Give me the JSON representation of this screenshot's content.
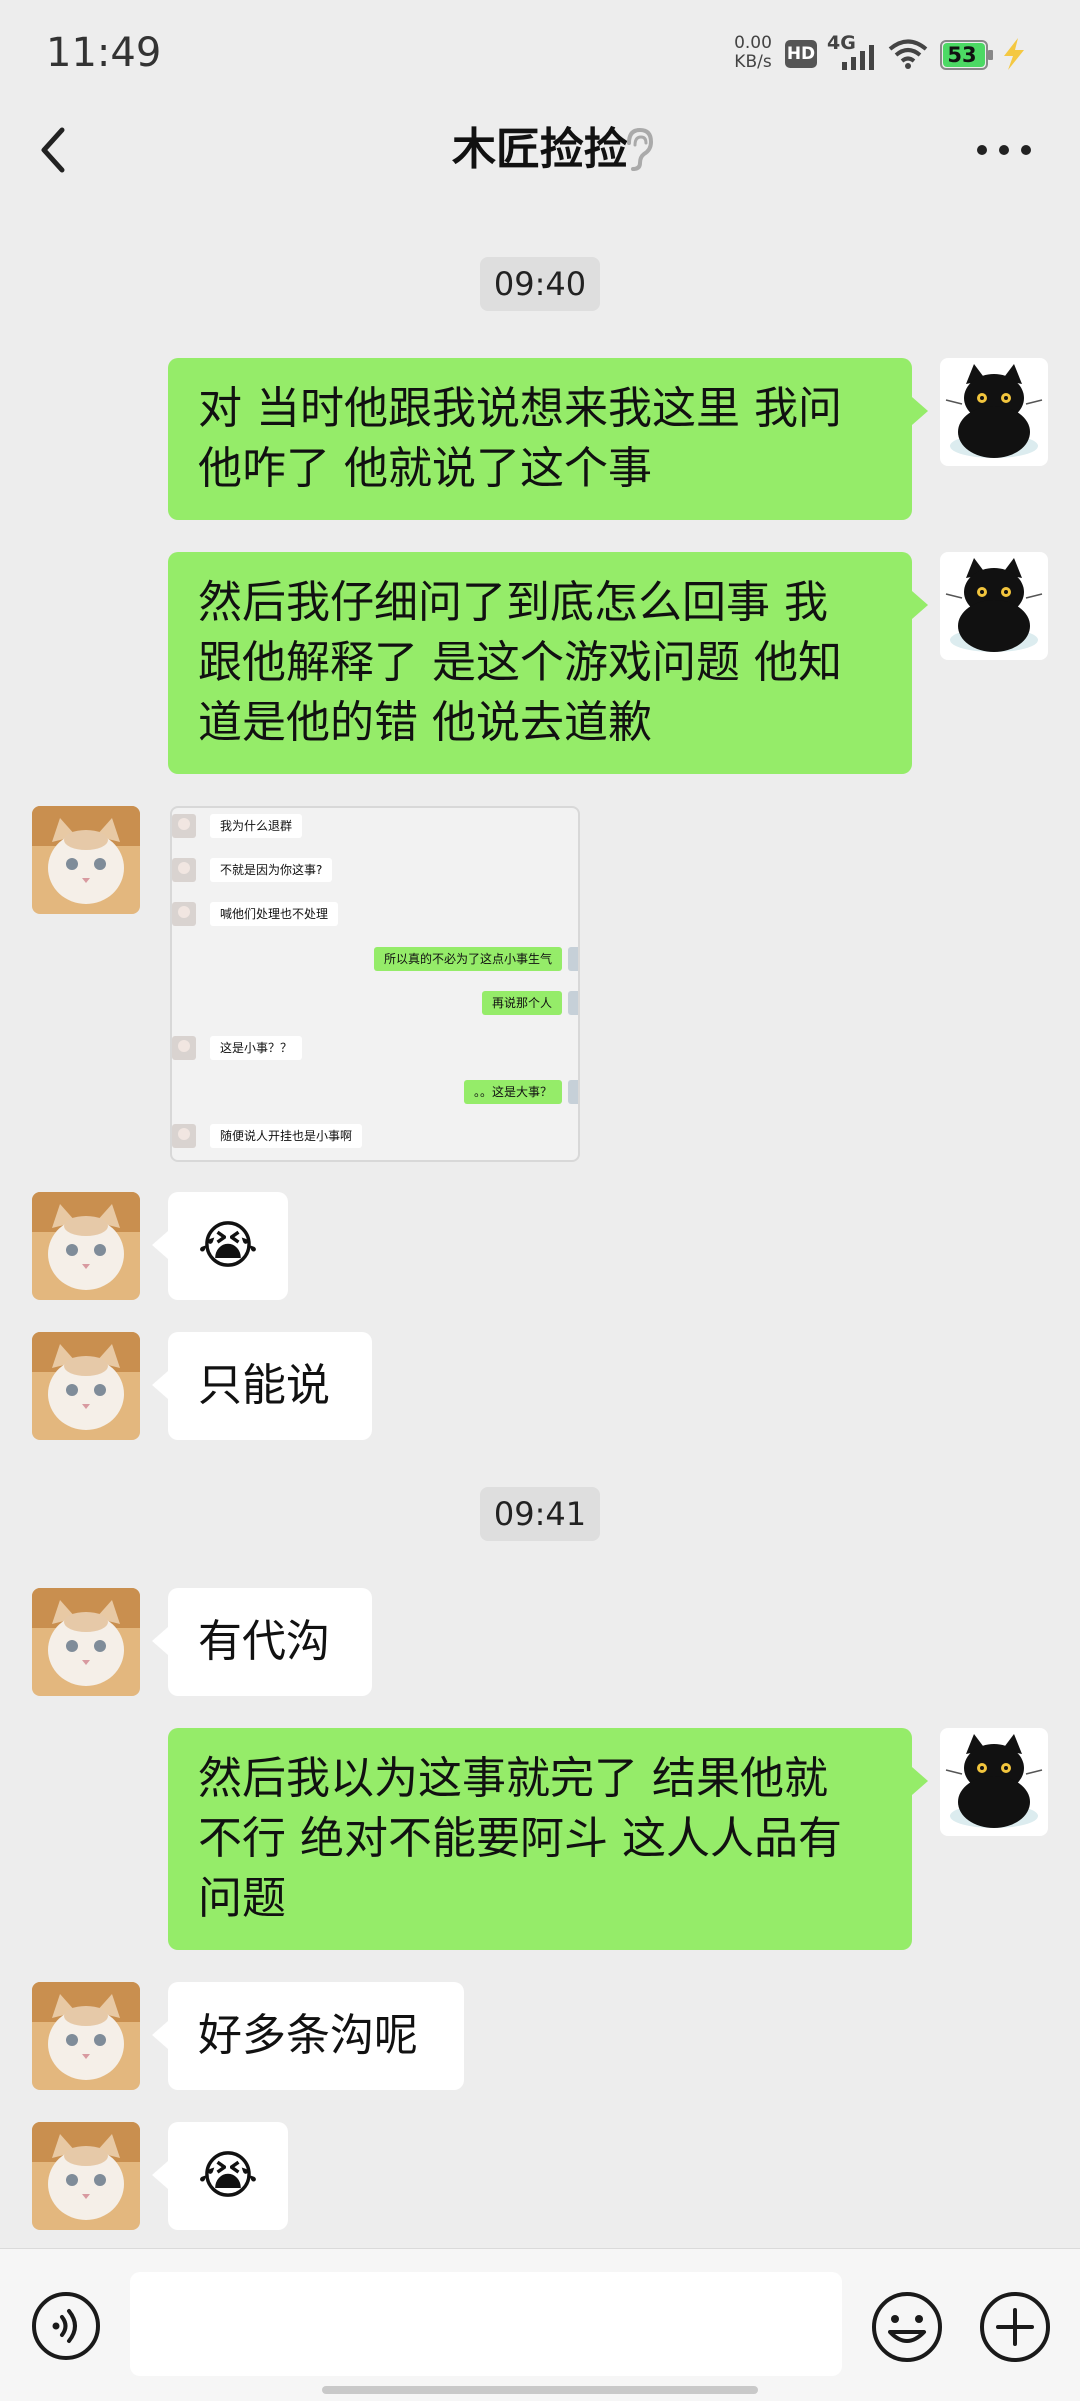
{
  "status": {
    "time": "11:49",
    "net_speed_value": "0.00",
    "net_speed_unit": "KB/s",
    "hd": "HD",
    "network": "4G",
    "battery": "53"
  },
  "header": {
    "title": "木匠捡捡",
    "icons": [
      "back-icon",
      "ear-icon",
      "more-icon"
    ]
  },
  "messages": [
    {
      "type": "time",
      "text": "09:40"
    },
    {
      "type": "text",
      "from": "me",
      "lines": [
        "对 当时他跟我说想来我这里 我问",
        "他咋了 他就说了这个事"
      ]
    },
    {
      "type": "text",
      "from": "me",
      "lines": [
        "然后我仔细问了到底怎么回事 我",
        "跟他解释了 是这个游戏问题 他知",
        "道是他的错 他说去道歉"
      ]
    },
    {
      "type": "image",
      "from": "other",
      "screenshot": [
        {
          "from": "other",
          "text": "我为什么退群"
        },
        {
          "from": "other",
          "text": "不就是因为你这事?"
        },
        {
          "from": "other",
          "text": "喊他们处理也不处理"
        },
        {
          "from": "me",
          "text": "所以真的不必为了这点小事生气"
        },
        {
          "from": "me",
          "text": "再说那个人"
        },
        {
          "from": "other",
          "text": "这是小事？？"
        },
        {
          "from": "me",
          "text": "。。这是大事？"
        },
        {
          "from": "other",
          "text": "随便说人开挂也是小事啊"
        }
      ]
    },
    {
      "type": "emoji",
      "from": "other",
      "text": "😭"
    },
    {
      "type": "text",
      "from": "other",
      "lines": [
        "只能说"
      ]
    },
    {
      "type": "time",
      "text": "09:41"
    },
    {
      "type": "text",
      "from": "other",
      "lines": [
        "有代沟"
      ]
    },
    {
      "type": "text",
      "from": "me",
      "lines": [
        "然后我以为这事就完了 结果他就",
        "不行 绝对不能要阿斗 这人人品有",
        "问题"
      ]
    },
    {
      "type": "text",
      "from": "other",
      "lines": [
        "好多条沟呢"
      ]
    },
    {
      "type": "emoji",
      "from": "other",
      "text": "😭"
    }
  ],
  "input": {
    "value": "",
    "icons": [
      "voice-icon",
      "emoji-icon",
      "plus-icon"
    ]
  },
  "colors": {
    "background": "#ededed",
    "my_bubble": "#95ec69",
    "their_bubble": "#ffffff",
    "battery_fill": "#4cd964"
  }
}
